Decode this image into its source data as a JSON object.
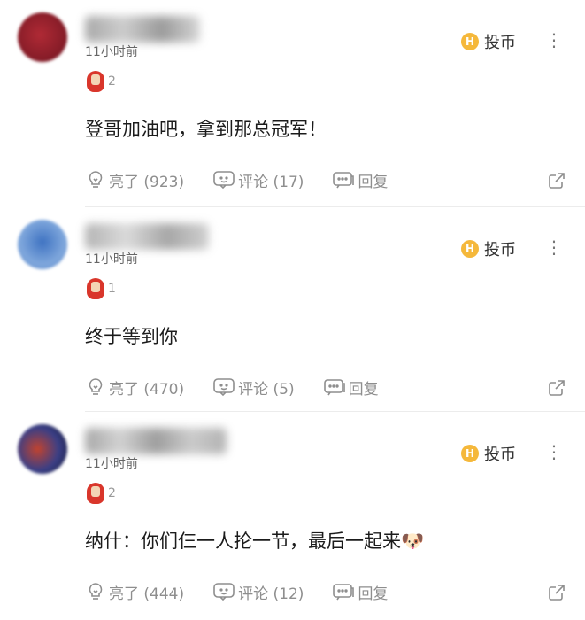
{
  "comments": [
    {
      "time": "11小时前",
      "badge_count": "2",
      "tip_label": "投币",
      "more_label": "⋮",
      "text": "登哥加油吧，拿到那总冠军！",
      "like_label": "亮了 (923)",
      "comment_label": "评论 (17)",
      "reply_label": "回复",
      "avatar_color": "#9a2028"
    },
    {
      "time": "11小时前",
      "badge_count": "1",
      "tip_label": "投币",
      "more_label": "⋮",
      "text": "终于等到你",
      "like_label": "亮了 (470)",
      "comment_label": "评论 (5)",
      "reply_label": "回复",
      "avatar_color": "#4a7fc6"
    },
    {
      "time": "11小时前",
      "badge_count": "2",
      "tip_label": "投币",
      "more_label": "⋮",
      "text": "纳什：你们仨一人抡一节，最后一起来🐶",
      "like_label": "亮了 (444)",
      "comment_label": "评论 (12)",
      "reply_label": "回复",
      "avatar_color": "#2b2f5c"
    }
  ],
  "colors": {
    "coin": "#f5b83b",
    "badge": "#d9362b",
    "action_text": "#8e8e8e",
    "divider": "#ececec"
  },
  "icons": [
    "thumbs-up-bulb-icon",
    "comment-bubble-icon",
    "reply-bubble-icon",
    "share-icon",
    "coin-icon",
    "more-icon",
    "medal-icon"
  ]
}
